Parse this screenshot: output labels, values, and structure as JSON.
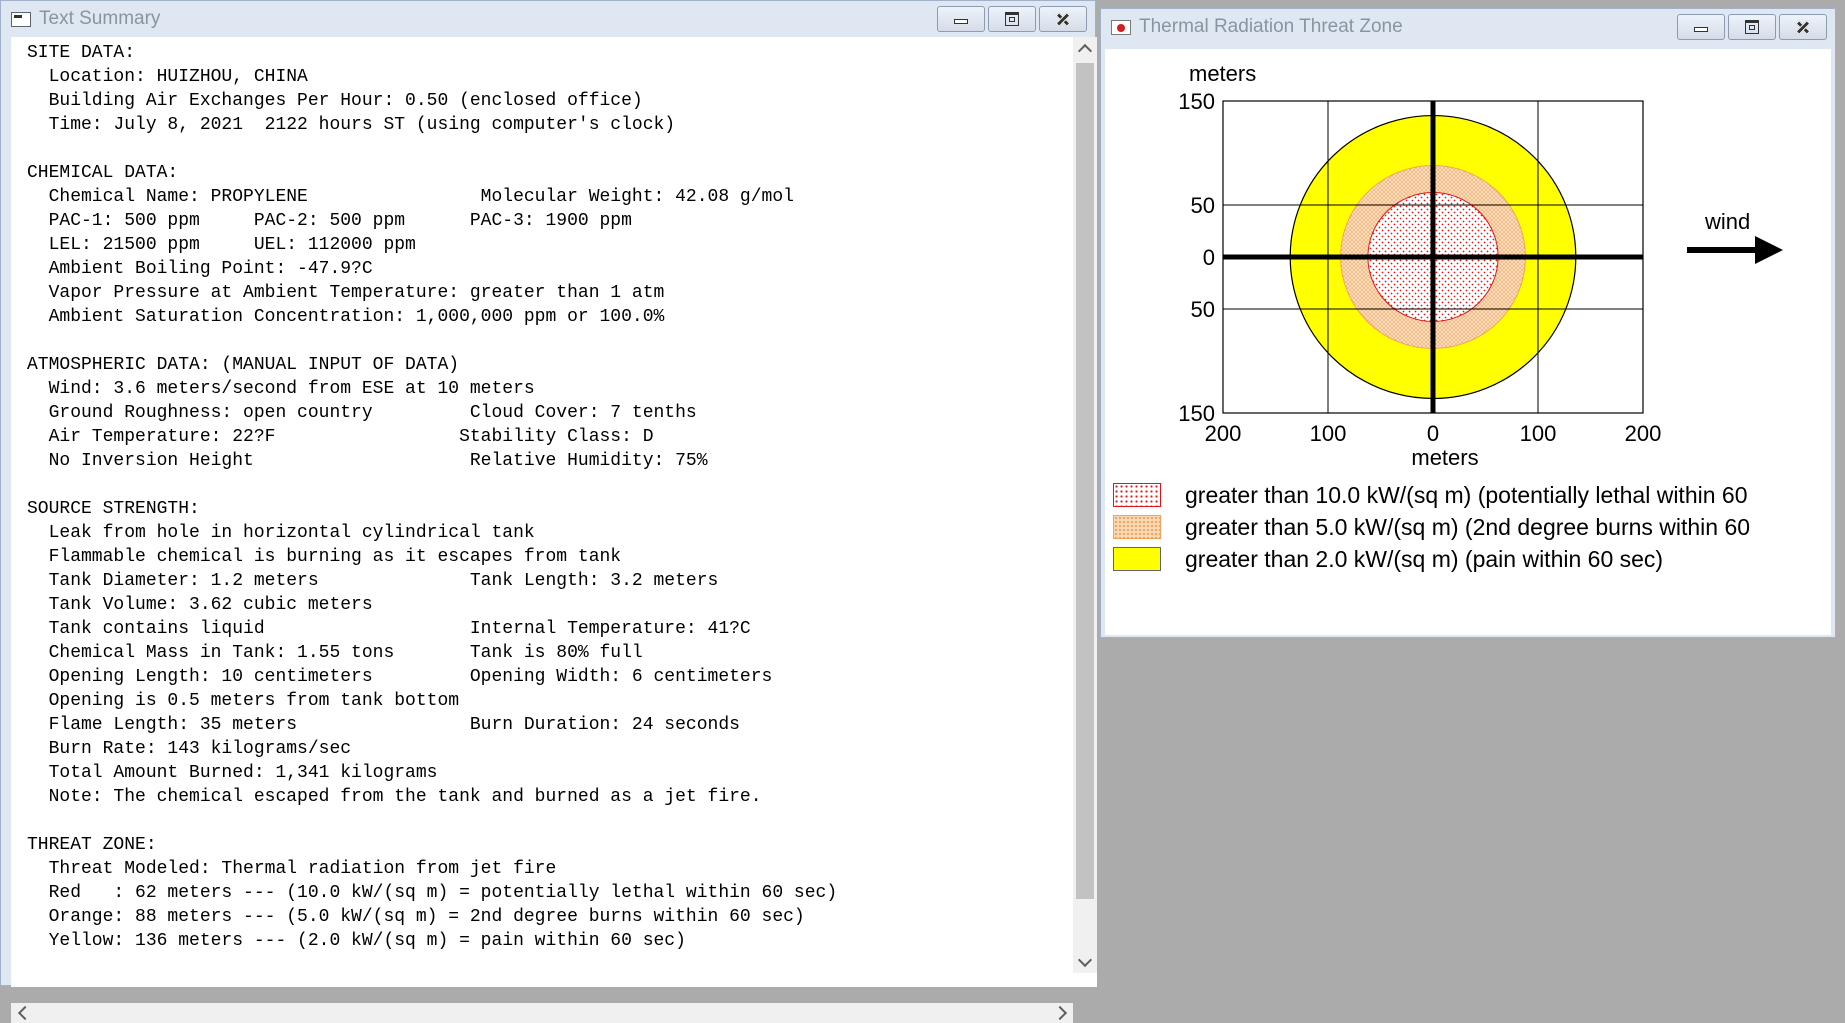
{
  "text_window": {
    "title": "Text Summary",
    "lines": [
      "SITE DATA:",
      "  Location: HUIZHOU, CHINA",
      "  Building Air Exchanges Per Hour: 0.50 (enclosed office)",
      "  Time: July 8, 2021  2122 hours ST (using computer's clock)",
      "",
      "CHEMICAL DATA:",
      "  Chemical Name: PROPYLENE                Molecular Weight: 42.08 g/mol",
      "  PAC-1: 500 ppm     PAC-2: 500 ppm      PAC-3: 1900 ppm",
      "  LEL: 21500 ppm     UEL: 112000 ppm",
      "  Ambient Boiling Point: -47.9?C",
      "  Vapor Pressure at Ambient Temperature: greater than 1 atm",
      "  Ambient Saturation Concentration: 1,000,000 ppm or 100.0%",
      "",
      "ATMOSPHERIC DATA: (MANUAL INPUT OF DATA)",
      "  Wind: 3.6 meters/second from ESE at 10 meters",
      "  Ground Roughness: open country         Cloud Cover: 7 tenths",
      "  Air Temperature: 22?F                 Stability Class: D",
      "  No Inversion Height                    Relative Humidity: 75%",
      "",
      "SOURCE STRENGTH:",
      "  Leak from hole in horizontal cylindrical tank",
      "  Flammable chemical is burning as it escapes from tank",
      "  Tank Diameter: 1.2 meters              Tank Length: 3.2 meters",
      "  Tank Volume: 3.62 cubic meters",
      "  Tank contains liquid                   Internal Temperature: 41?C",
      "  Chemical Mass in Tank: 1.55 tons       Tank is 80% full",
      "  Opening Length: 10 centimeters         Opening Width: 6 centimeters",
      "  Opening is 0.5 meters from tank bottom",
      "  Flame Length: 35 meters                Burn Duration: 24 seconds",
      "  Burn Rate: 143 kilograms/sec",
      "  Total Amount Burned: 1,341 kilograms",
      "  Note: The chemical escaped from the tank and burned as a jet fire.",
      "",
      "THREAT ZONE:",
      "  Threat Modeled: Thermal radiation from jet fire",
      "  Red   : 62 meters --- (10.0 kW/(sq m) = potentially lethal within 60 sec)",
      "  Orange: 88 meters --- (5.0 kW/(sq m) = 2nd degree burns within 60 sec)",
      "  Yellow: 136 meters --- (2.0 kW/(sq m) = pain within 60 sec)"
    ]
  },
  "threat_window": {
    "title": "Thermal Radiation Threat Zone",
    "wind_label": "wind",
    "legend": [
      {
        "label": "greater than 10.0 kW/(sq m) (potentially lethal within 60",
        "color": "#e01515"
      },
      {
        "label": "greater than 5.0 kW/(sq m) (2nd degree burns within 60",
        "color": "#f7c48f"
      },
      {
        "label": "greater than 2.0 kW/(sq m) (pain within 60 sec)",
        "color": "#ffff00"
      }
    ]
  },
  "chart_data": {
    "type": "scatter",
    "xlabel": "meters",
    "ylabel": "meters",
    "xlim": [
      -200,
      200
    ],
    "ylim": [
      -150,
      150
    ],
    "x_ticks": [
      -200,
      -100,
      0,
      100,
      200
    ],
    "x_tick_labels": [
      "200",
      "100",
      "0",
      "100",
      "200"
    ],
    "y_ticks": [
      150,
      50,
      0,
      -50,
      -150
    ],
    "y_tick_labels": [
      "150",
      "50",
      "0",
      "50",
      "150"
    ],
    "grid": true,
    "zones": [
      {
        "color": "yellow",
        "radius_m": 136,
        "fill": "#ffff00"
      },
      {
        "color": "orange",
        "radius_m": 88,
        "fill": "#f9d9b3"
      },
      {
        "color": "red",
        "radius_m": 62,
        "fill": "#ffffff"
      }
    ]
  }
}
